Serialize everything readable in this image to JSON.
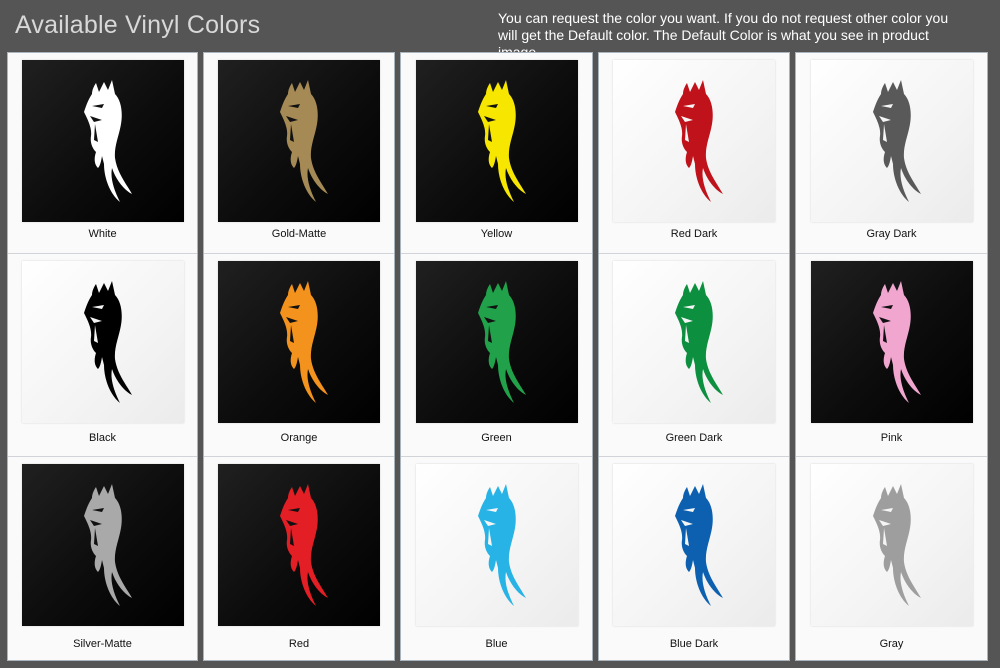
{
  "header": {
    "title": "Available Vinyl Colors",
    "note": "You can request the color you want. If you do not request other color you will get the Default color. The Default Color is what you see in product image."
  },
  "columns": [
    {
      "cells": [
        {
          "label": "White",
          "color": "#ffffff",
          "background": "dark"
        },
        {
          "label": "Black",
          "color": "#000000",
          "background": "light"
        },
        {
          "label": "Silver-Matte",
          "color": "#a9a9a9",
          "background": "dark"
        }
      ]
    },
    {
      "cells": [
        {
          "label": "Gold-Matte",
          "color": "#a58a55",
          "background": "dark"
        },
        {
          "label": "Orange",
          "color": "#f3921c",
          "background": "dark"
        },
        {
          "label": "Red",
          "color": "#e31e24",
          "background": "dark"
        }
      ]
    },
    {
      "cells": [
        {
          "label": "Yellow",
          "color": "#f6e600",
          "background": "dark"
        },
        {
          "label": "Green",
          "color": "#21a24a",
          "background": "dark"
        },
        {
          "label": "Blue",
          "color": "#27b3e6",
          "background": "light"
        }
      ]
    },
    {
      "cells": [
        {
          "label": "Red Dark",
          "color": "#c0121a",
          "background": "light"
        },
        {
          "label": "Green Dark",
          "color": "#0c8f3e",
          "background": "light"
        },
        {
          "label": "Blue Dark",
          "color": "#0d60b0",
          "background": "light"
        }
      ]
    },
    {
      "cells": [
        {
          "label": "Gray Dark",
          "color": "#595959",
          "background": "light"
        },
        {
          "label": "Pink",
          "color": "#f0a6cf",
          "background": "dark"
        },
        {
          "label": "Gray",
          "color": "#9e9e9e",
          "background": "light"
        }
      ]
    }
  ],
  "icons": {
    "swatch_graphic": "horse-head-icon"
  }
}
